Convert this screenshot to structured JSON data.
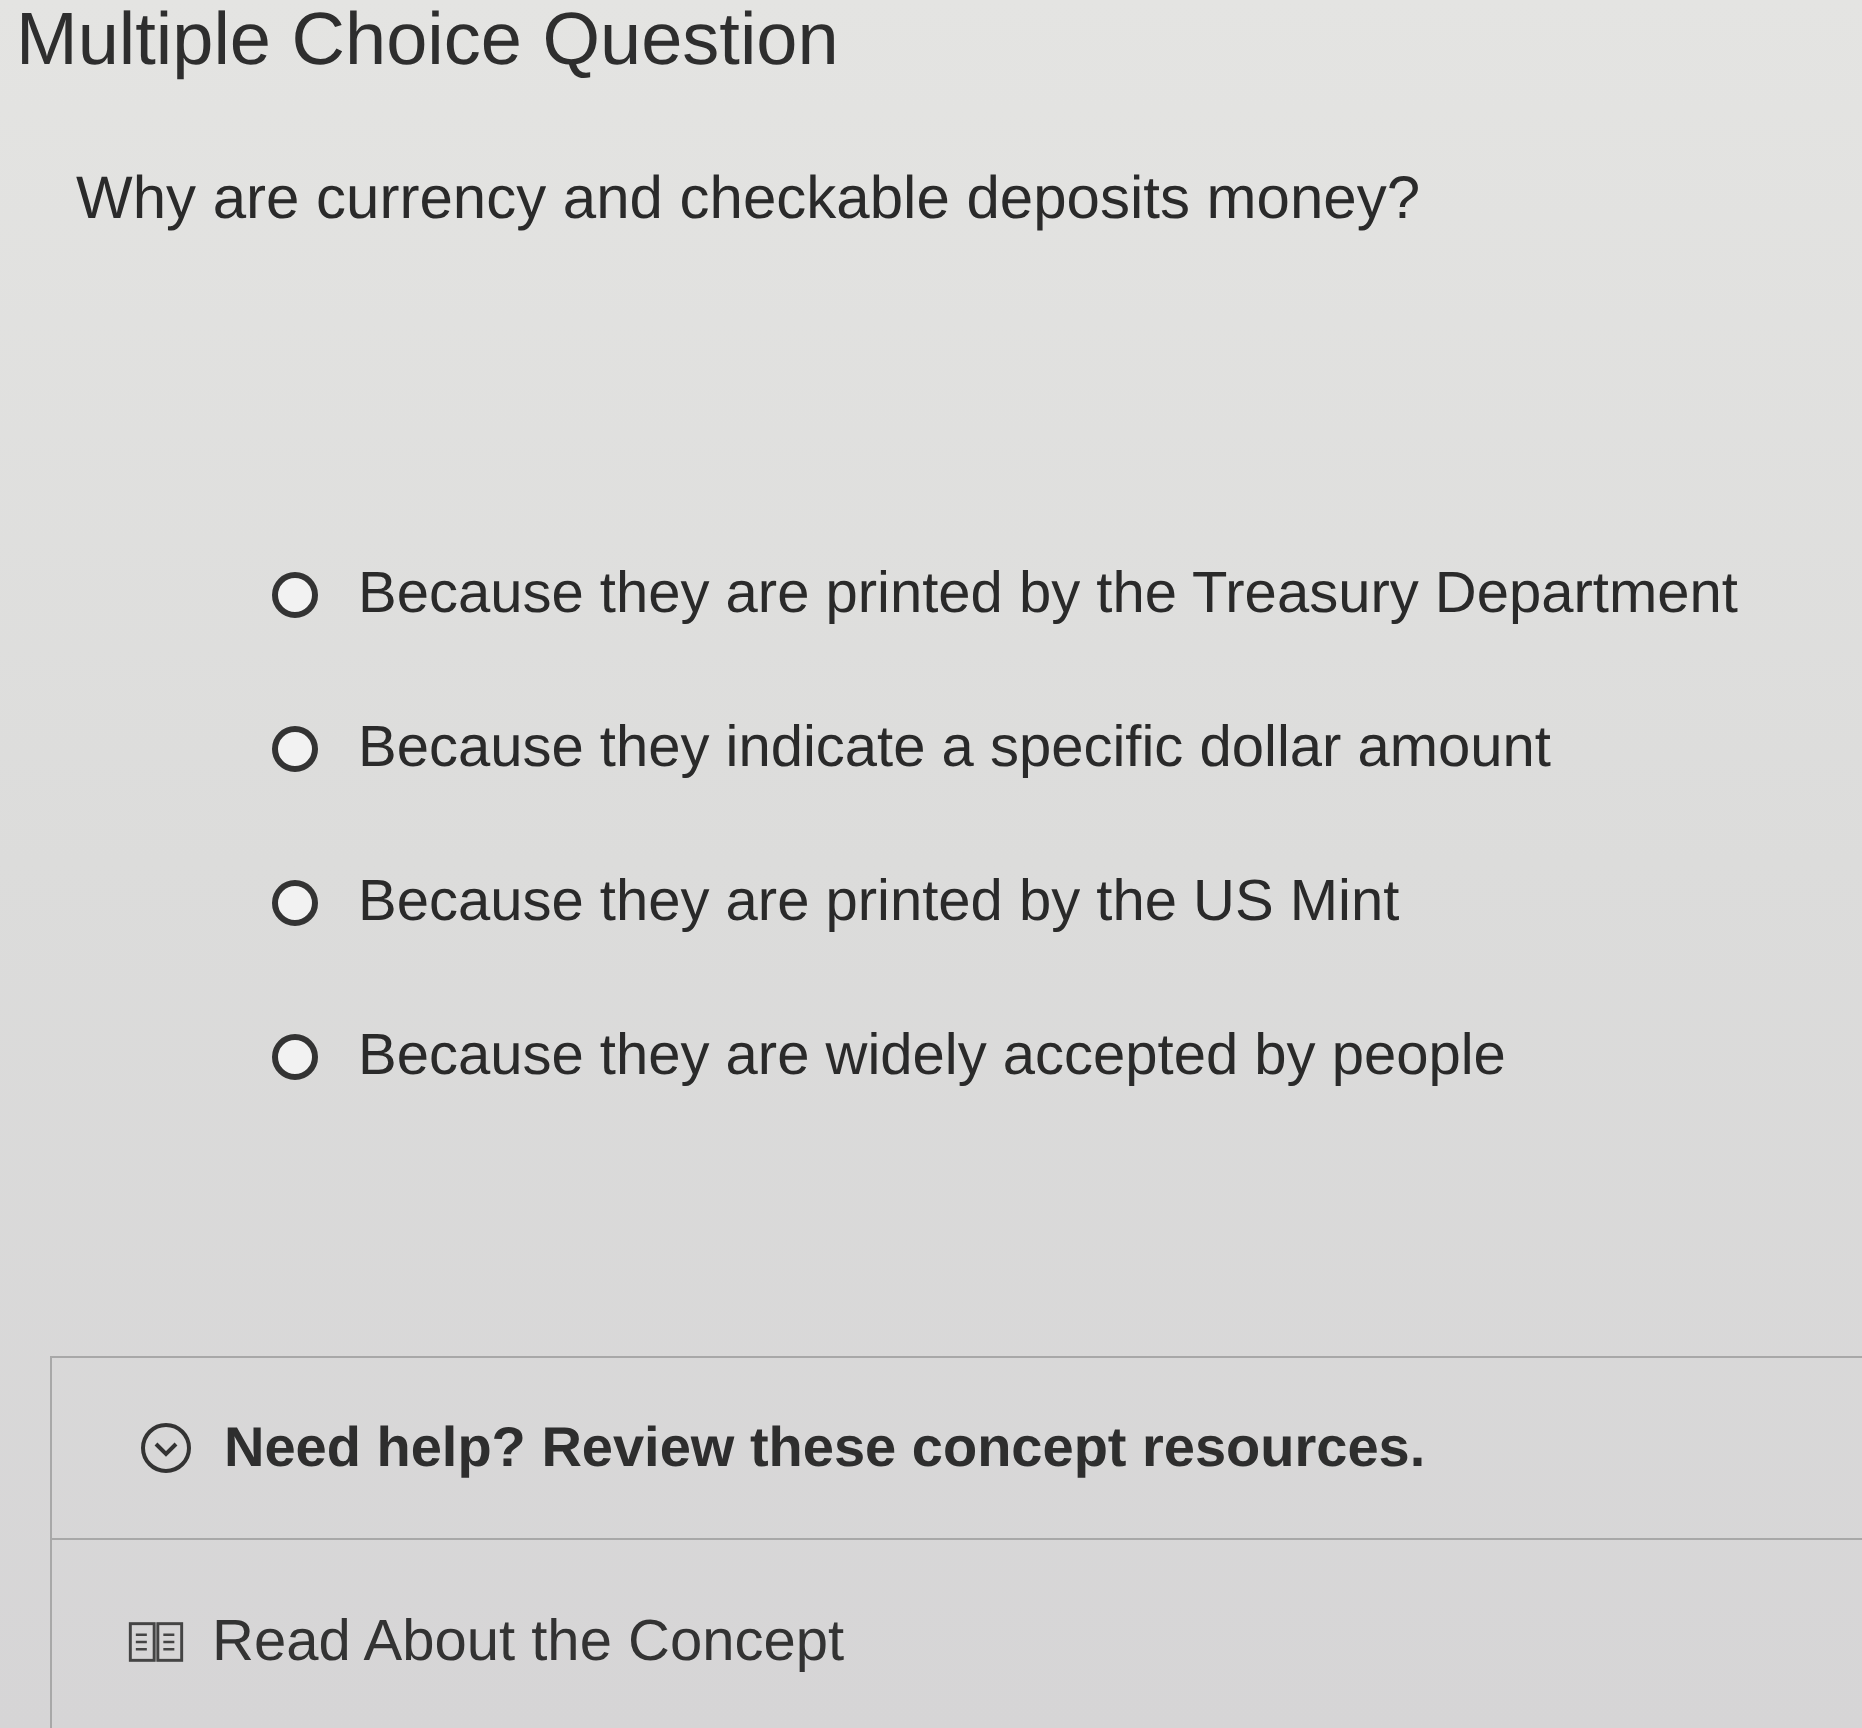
{
  "header": {
    "title": "Multiple Choice Question"
  },
  "question": {
    "prompt": "Why are currency and checkable deposits money?"
  },
  "options": [
    {
      "label": "Because they are printed by the Treasury Department",
      "selected": false
    },
    {
      "label": "Because they indicate a specific dollar amount",
      "selected": false
    },
    {
      "label": "Because they are printed by the US Mint",
      "selected": false
    },
    {
      "label": "Because they are widely accepted by people",
      "selected": false
    }
  ],
  "help": {
    "title": "Need help? Review these concept resources."
  },
  "resources": [
    {
      "label": "Read About the Concept"
    }
  ]
}
